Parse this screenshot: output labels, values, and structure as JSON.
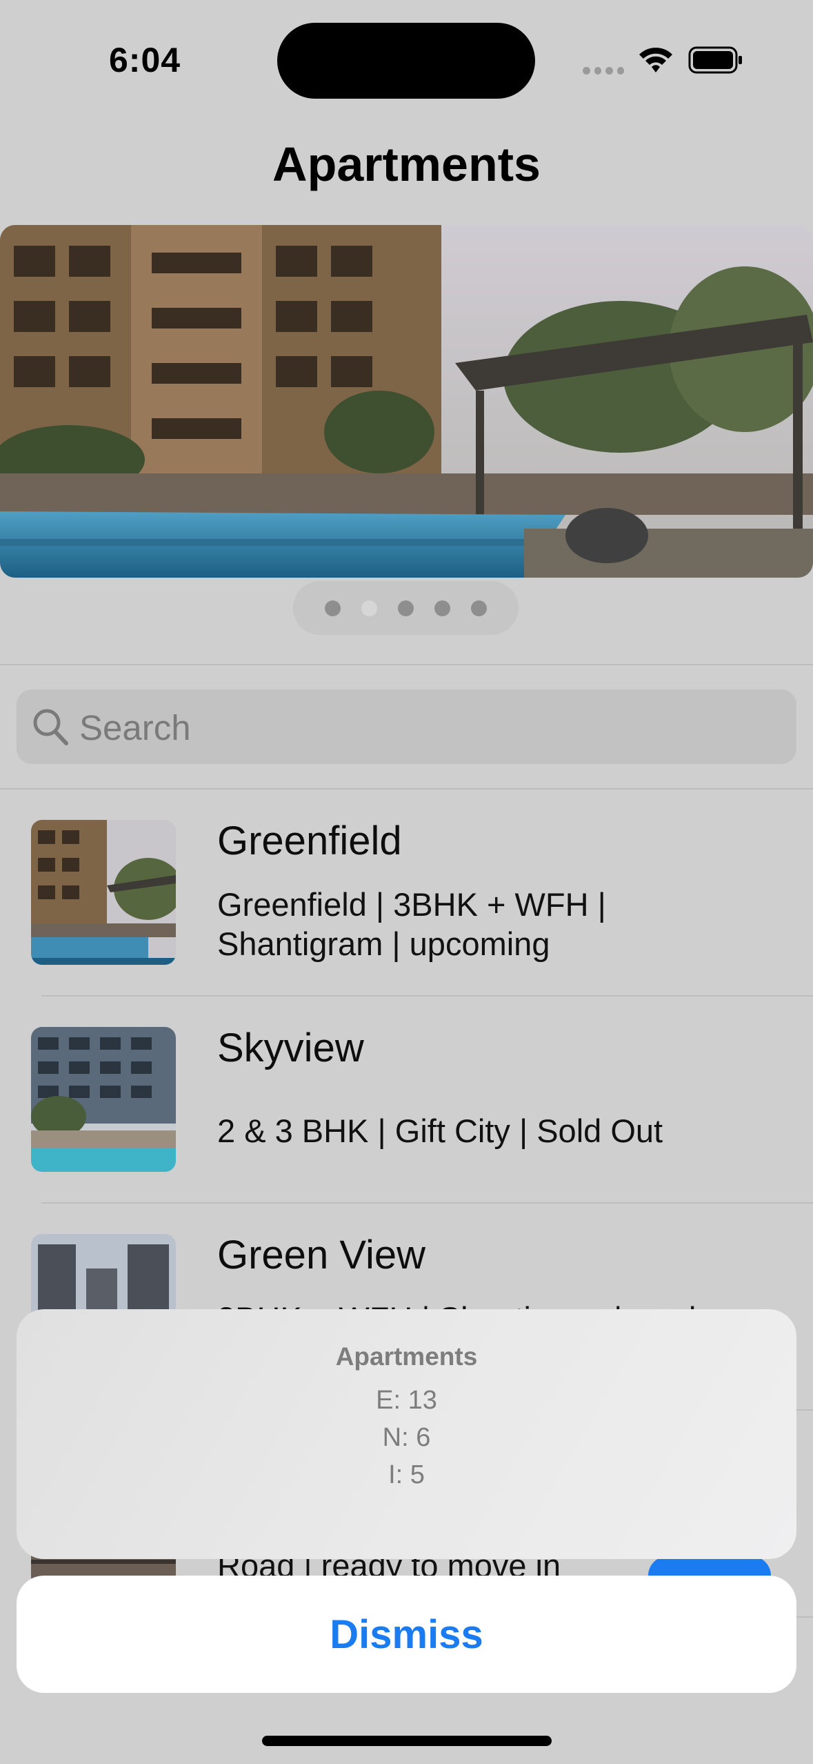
{
  "status_bar": {
    "time": "6:04"
  },
  "nav": {
    "title": "Apartments"
  },
  "carousel": {
    "page_count": 5,
    "current_page": 2
  },
  "search": {
    "placeholder": "Search"
  },
  "list": {
    "items": [
      {
        "title": "Greenfield",
        "subtitle_line1": "Greenfield | 3BHK + WFH |",
        "subtitle_line2": "Shantigram | upcoming"
      },
      {
        "title": "Skyview",
        "subtitle_line1": "2 & 3 BHK | Gift City | Sold Out"
      },
      {
        "title": "Green View",
        "subtitle_partial": "3BHK + WFH | Shantigram | ready"
      },
      {
        "subtitle_partial": "Road | ready to move in"
      }
    ]
  },
  "alert": {
    "title": "Apartments",
    "lines": [
      "E: 13",
      "N: 6",
      "I: 5"
    ],
    "dismiss_label": "Dismiss"
  },
  "colors": {
    "accent": "#1a7cf0",
    "background": "#cfcfcf"
  }
}
